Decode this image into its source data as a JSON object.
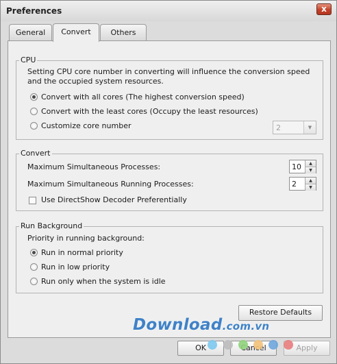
{
  "window": {
    "title": "Preferences",
    "close_label": "x"
  },
  "tabs": [
    {
      "label": "General",
      "active": false
    },
    {
      "label": "Convert",
      "active": true
    },
    {
      "label": "Others",
      "active": false
    }
  ],
  "cpu": {
    "legend": "CPU",
    "description": "Setting CPU core number in converting will influence the conversion speed and the occupied system resources.",
    "options": [
      {
        "label": "Convert with all cores (The highest conversion speed)",
        "checked": true
      },
      {
        "label": "Convert with the least cores (Occupy the least resources)",
        "checked": false
      },
      {
        "label": "Customize core number",
        "checked": false
      }
    ],
    "core_number": "2"
  },
  "convert": {
    "legend": "Convert",
    "max_processes_label": "Maximum Simultaneous Processes:",
    "max_processes_value": "10",
    "max_running_label": "Maximum Simultaneous Running Processes:",
    "max_running_value": "2",
    "directshow_label": "Use DirectShow Decoder Preferentially",
    "directshow_checked": false
  },
  "run_background": {
    "legend": "Run Background",
    "priority_label": "Priority in running background:",
    "options": [
      {
        "label": "Run in normal priority",
        "checked": true
      },
      {
        "label": "Run in low priority",
        "checked": false
      },
      {
        "label": "Run only when the system is idle",
        "checked": false
      }
    ]
  },
  "buttons": {
    "restore_defaults": "Restore Defaults",
    "ok": "OK",
    "cancel": "Cancel",
    "apply": "Apply"
  },
  "watermark": {
    "brand": "Download",
    "tld": ".com.vn"
  },
  "colors": {
    "accent": "#3f82c7",
    "close_button": "#c5432a",
    "watermark_dots": [
      "#7cc8f0",
      "#bdbdbd",
      "#8fd17a",
      "#f2c27a",
      "#6ea6dc",
      "#e87c7c"
    ]
  }
}
